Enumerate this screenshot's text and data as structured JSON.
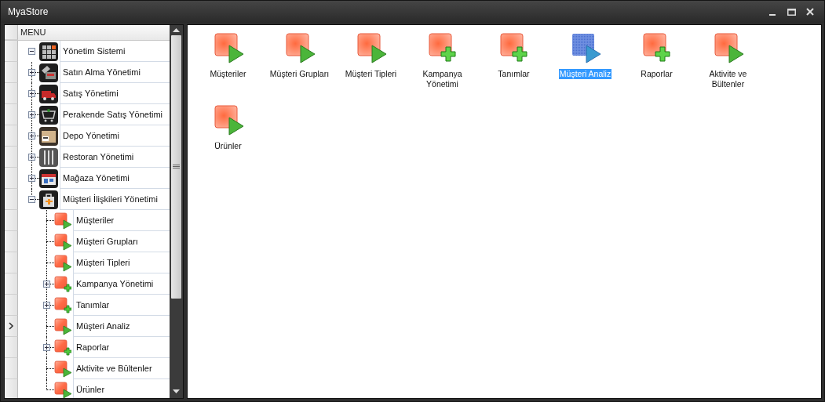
{
  "window": {
    "title": "MyaStore"
  },
  "menu": {
    "header": "MENU",
    "root": {
      "label": "Yönetim Sistemi",
      "expanded": true,
      "selected": false,
      "children": [
        {
          "label": "Satın Alma Yönetimi",
          "expanded": false,
          "selected": false
        },
        {
          "label": "Satış Yönetimi",
          "expanded": false,
          "selected": false
        },
        {
          "label": "Perakende Satış Yönetimi",
          "expanded": false,
          "selected": false
        },
        {
          "label": "Depo Yönetimi",
          "expanded": false,
          "selected": false
        },
        {
          "label": "Restoran Yönetimi",
          "expanded": false,
          "selected": false
        },
        {
          "label": "Mağaza Yönetimi",
          "expanded": false,
          "selected": false
        },
        {
          "label": "Müşteri İlişkileri Yönetimi",
          "expanded": true,
          "selected": false,
          "children": [
            {
              "label": "Müşteriler",
              "kind": "item",
              "selected": false
            },
            {
              "label": "Müşteri Grupları",
              "kind": "item",
              "selected": false
            },
            {
              "label": "Müşteri Tipleri",
              "kind": "item",
              "selected": false
            },
            {
              "label": "Kampanya Yönetimi",
              "kind": "group",
              "expanded": false,
              "selected": false
            },
            {
              "label": "Tanımlar",
              "kind": "group",
              "expanded": false,
              "selected": false
            },
            {
              "label": "Müşteri Analiz",
              "kind": "item",
              "selected": true
            },
            {
              "label": "Raporlar",
              "kind": "group",
              "expanded": false,
              "selected": false
            },
            {
              "label": "Aktivite ve Bültenler",
              "kind": "item",
              "selected": false
            },
            {
              "label": "Ürünler",
              "kind": "item",
              "selected": false
            }
          ]
        }
      ]
    }
  },
  "tiles": [
    {
      "label": "Müşteriler",
      "kind": "item",
      "selected": false
    },
    {
      "label": "Müşteri Grupları",
      "kind": "item",
      "selected": false
    },
    {
      "label": "Müşteri Tipleri",
      "kind": "item",
      "selected": false
    },
    {
      "label": "Kampanya Yönetimi",
      "kind": "group",
      "selected": false
    },
    {
      "label": "Tanımlar",
      "kind": "group",
      "selected": false
    },
    {
      "label": "Müşteri Analiz",
      "kind": "item",
      "selected": true
    },
    {
      "label": "Raporlar",
      "kind": "group",
      "selected": false
    },
    {
      "label": "Aktivite ve Bültenler",
      "kind": "item",
      "selected": false
    },
    {
      "label": "Ürünler",
      "kind": "item",
      "selected": false
    }
  ]
}
